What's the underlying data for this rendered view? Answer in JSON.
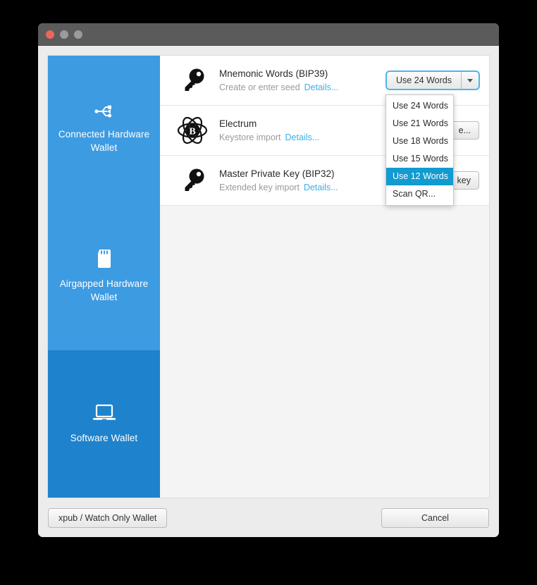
{
  "window": {
    "traffic_lights": [
      "close",
      "minimize",
      "maximize"
    ],
    "title": ""
  },
  "sidebar": {
    "items": [
      {
        "label": "Connected Hardware Wallet",
        "icon": "usb-icon",
        "selected": false
      },
      {
        "label": "Airgapped Hardware Wallet",
        "icon": "sdcard-icon",
        "selected": false
      },
      {
        "label": "Software Wallet",
        "icon": "laptop-icon",
        "selected": true
      }
    ]
  },
  "main": {
    "rows": [
      {
        "title": "Mnemonic Words (BIP39)",
        "subtitle": "Create or enter seed",
        "details_label": "Details...",
        "icon": "key-icon",
        "action_label": "Use 24 Words",
        "action_type": "split-button"
      },
      {
        "title": "Electrum",
        "subtitle": "Keystore import",
        "details_label": "Details...",
        "icon": "electrum-atom-icon",
        "action_label": "e...",
        "action_type": "button"
      },
      {
        "title": "Master Private Key (BIP32)",
        "subtitle": "Extended key import",
        "details_label": "Details...",
        "icon": "key-icon",
        "action_label": "key",
        "action_type": "button"
      }
    ]
  },
  "dropdown": {
    "open": true,
    "items": [
      {
        "label": "Use 24 Words",
        "highlighted": false
      },
      {
        "label": "Use 21 Words",
        "highlighted": false
      },
      {
        "label": "Use 18 Words",
        "highlighted": false
      },
      {
        "label": "Use 15 Words",
        "highlighted": false
      },
      {
        "label": "Use 12 Words",
        "highlighted": true
      },
      {
        "label": "Scan QR...",
        "highlighted": false
      }
    ]
  },
  "footer": {
    "xpub_label": "xpub / Watch Only Wallet",
    "cancel_label": "Cancel"
  },
  "colors": {
    "sidebar_blue": "#3d9be2",
    "sidebar_selected_blue": "#1e82cc",
    "highlight_blue": "#119bd0",
    "link_blue": "#3baee8",
    "titlebar_gray": "#5b5b5b",
    "content_gray": "#f4f4f4"
  }
}
